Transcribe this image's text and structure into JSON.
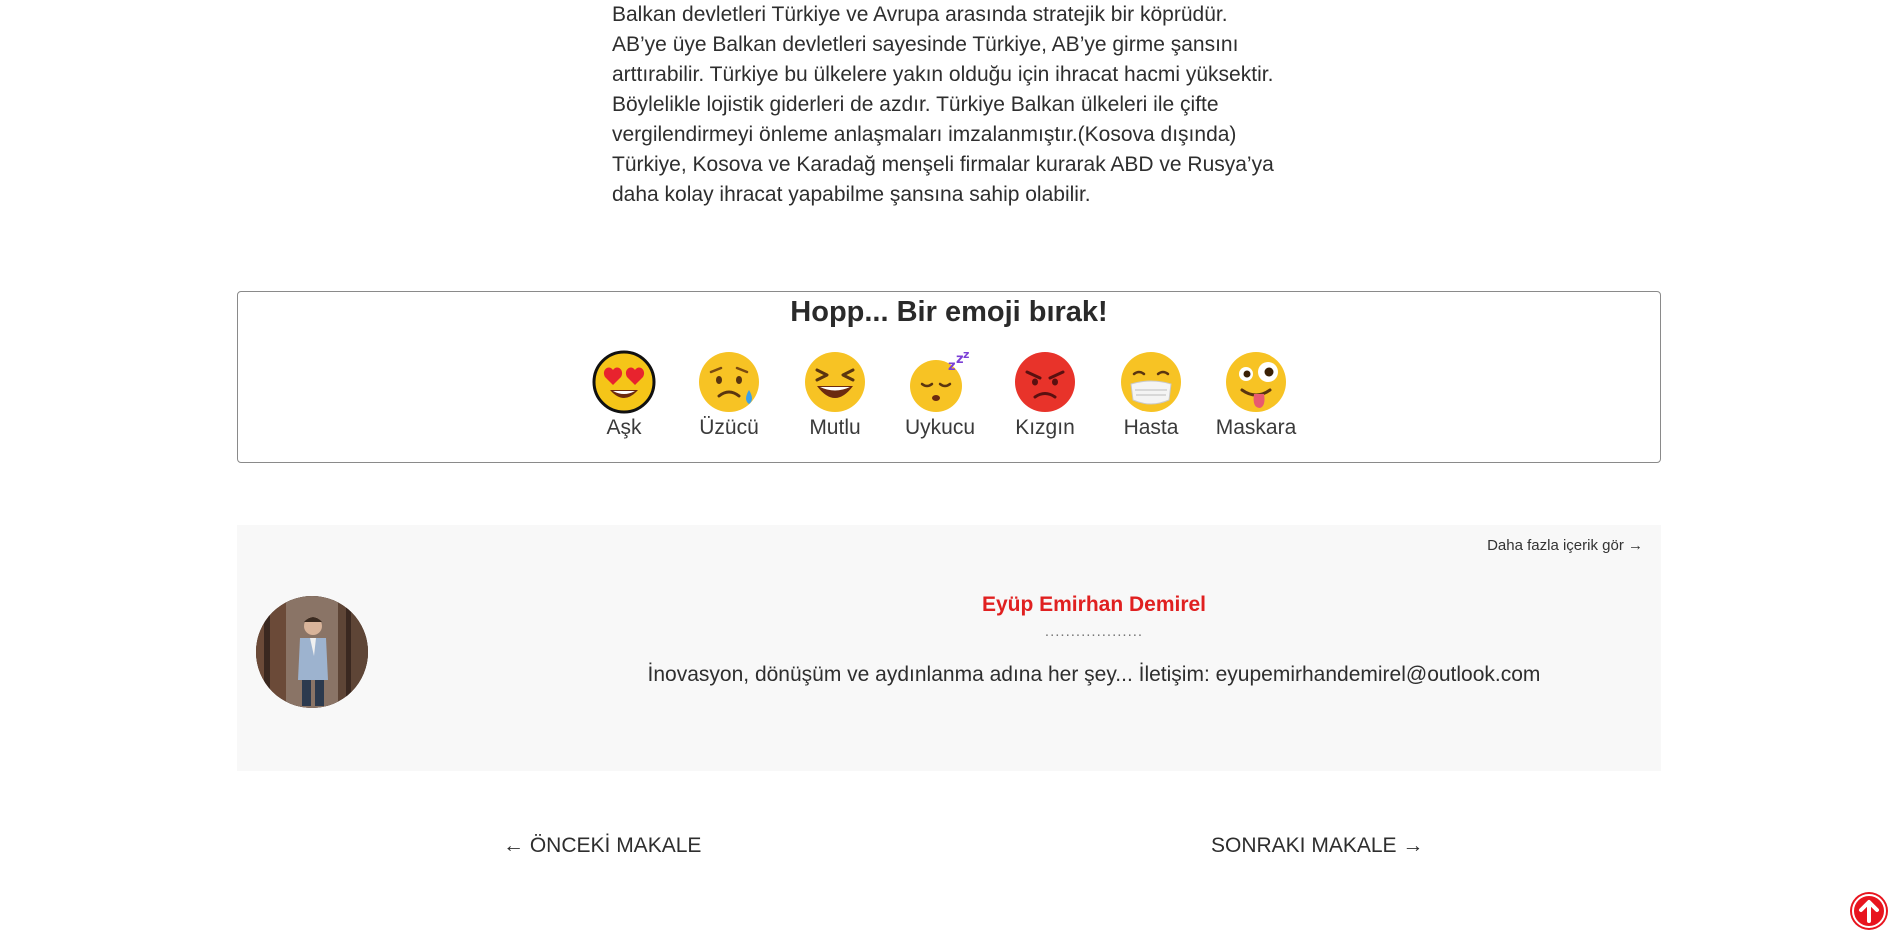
{
  "article": {
    "lines": [
      "Balkan devletleri Türkiye ve Avrupa arasında stratejik bir köprüdür.",
      "AB’ye üye Balkan devletleri sayesinde Türkiye, AB’ye girme şansını",
      "arttırabilir. Türkiye bu ülkelere yakın olduğu için ihracat hacmi yüksektir.",
      "Böylelikle lojistik giderleri de azdır. Türkiye Balkan ülkeleri ile çifte",
      "vergilendirmeyi önleme anlaşmaları imzalanmıştır.(Kosova dışında)",
      "Türkiye, Kosova ve Karadağ menşeli firmalar kurarak ABD ve Rusya’ya",
      "daha kolay ihracat yapabilme şansına sahip olabilir."
    ]
  },
  "emoji": {
    "title": "Hopp... Bir emoji bırak!",
    "items": [
      {
        "label": "Aşk",
        "icon": "heart-eyes-emoji-icon"
      },
      {
        "label": "Üzücü",
        "icon": "sad-sweat-emoji-icon"
      },
      {
        "label": "Mutlu",
        "icon": "laughing-emoji-icon"
      },
      {
        "label": "Uykucu",
        "icon": "sleeping-emoji-icon"
      },
      {
        "label": "Kızgın",
        "icon": "angry-emoji-icon"
      },
      {
        "label": "Hasta",
        "icon": "mask-emoji-icon"
      },
      {
        "label": "Maskara",
        "icon": "zany-emoji-icon"
      }
    ]
  },
  "author": {
    "more_link": "Daha fazla içerik gör",
    "name": "Eyüp Emirhan Demirel",
    "dots": "...................",
    "bio": "İnovasyon, dönüşüm ve aydınlanma adına her şey... İletişim: eyupemirhandemirel@outlook.com"
  },
  "nav": {
    "prev_label": "ÖNCEKİ MAKALE",
    "next_label": "SONRAKI MAKALE"
  },
  "colors": {
    "accent": "#e02020",
    "card_bg": "#f8f8f8",
    "scroll_button": "#e8141e"
  }
}
